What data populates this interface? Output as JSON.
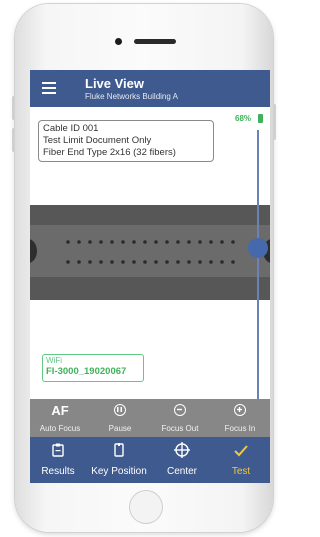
{
  "header": {
    "title": "Live View",
    "subtitle": "Fluke Networks Building A",
    "menu_icon": "hamburger-menu-icon"
  },
  "status": {
    "battery_percent": "68%",
    "battery_color": "#3fb25a"
  },
  "cable_info": {
    "line1": "Cable ID 001",
    "line2": "Test Limit Document Only",
    "line3": "Fiber End Type 2x16 (32 fibers)"
  },
  "focus_slider": {
    "level": 0.38
  },
  "wifi": {
    "label": "WiFi",
    "name": "FI-3000_19020067"
  },
  "controls": {
    "auto_focus": {
      "icon_text": "AF",
      "label": "Auto Focus"
    },
    "pause": {
      "icon": "pause-icon",
      "label": "Pause"
    },
    "focus_out": {
      "icon": "minus-circle-icon",
      "label": "Focus Out"
    },
    "focus_in": {
      "icon": "plus-circle-icon",
      "label": "Focus In"
    }
  },
  "nav": {
    "results": {
      "icon": "clipboard-icon",
      "label": "Results"
    },
    "key_position": {
      "icon": "key-connector-icon",
      "label": "Key Position"
    },
    "center": {
      "icon": "crosshair-icon",
      "label": "Center"
    },
    "test": {
      "icon": "checkmark-icon",
      "label": "Test"
    }
  },
  "colors": {
    "header_bg": "#3f5a8e",
    "controls_bg": "#878787",
    "active_accent": "#f0c93c",
    "wifi_green": "#5fc985"
  }
}
